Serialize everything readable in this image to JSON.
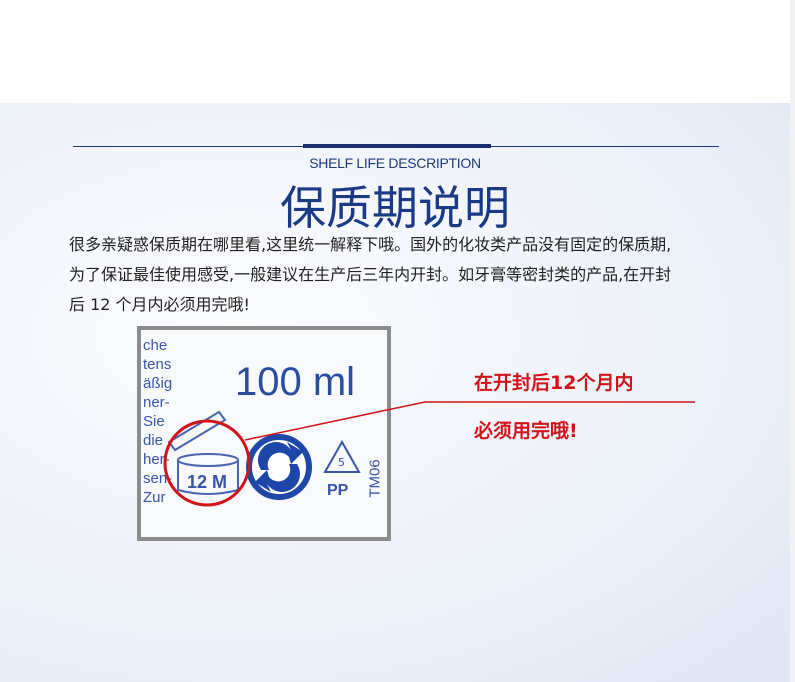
{
  "header": {
    "subtitle": "SHELF LIFE DESCRIPTION",
    "title": "保质期说明"
  },
  "description": {
    "lines": [
      "很多亲疑惑保质期在哪里看,这里统一解释下哦。国外的化妆类产品没有固定的保质期,",
      "为了保证最佳使用感受,一般建议在生产后三年内开封。如牙膏等密封类的产品,在开封",
      "后 12 个月内必须用完哦!"
    ]
  },
  "product_photo": {
    "volume": "100 ml",
    "pao_label": "12 M",
    "recycle_code": "5",
    "recycle_material": "PP",
    "code": "TM06",
    "side_text": [
      "che",
      "tens",
      "äßig",
      "ner-",
      "Sie",
      "die",
      "her-",
      "sen-",
      "Zur"
    ]
  },
  "annotation": {
    "line1": "在开封后12个月内",
    "line2": "必须用完哦!",
    "color": "#d0141a"
  },
  "colors": {
    "title": "#1a3a86",
    "accent": "#d0141a"
  }
}
